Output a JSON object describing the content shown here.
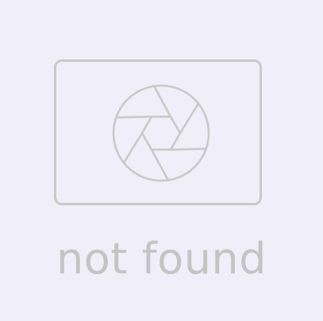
{
  "placeholder": {
    "message": "not found",
    "icon": "camera-aperture-icon",
    "colors": {
      "background": "#f0eff9",
      "stroke": "#c9c9c9",
      "text": "#c4c4c4"
    }
  }
}
